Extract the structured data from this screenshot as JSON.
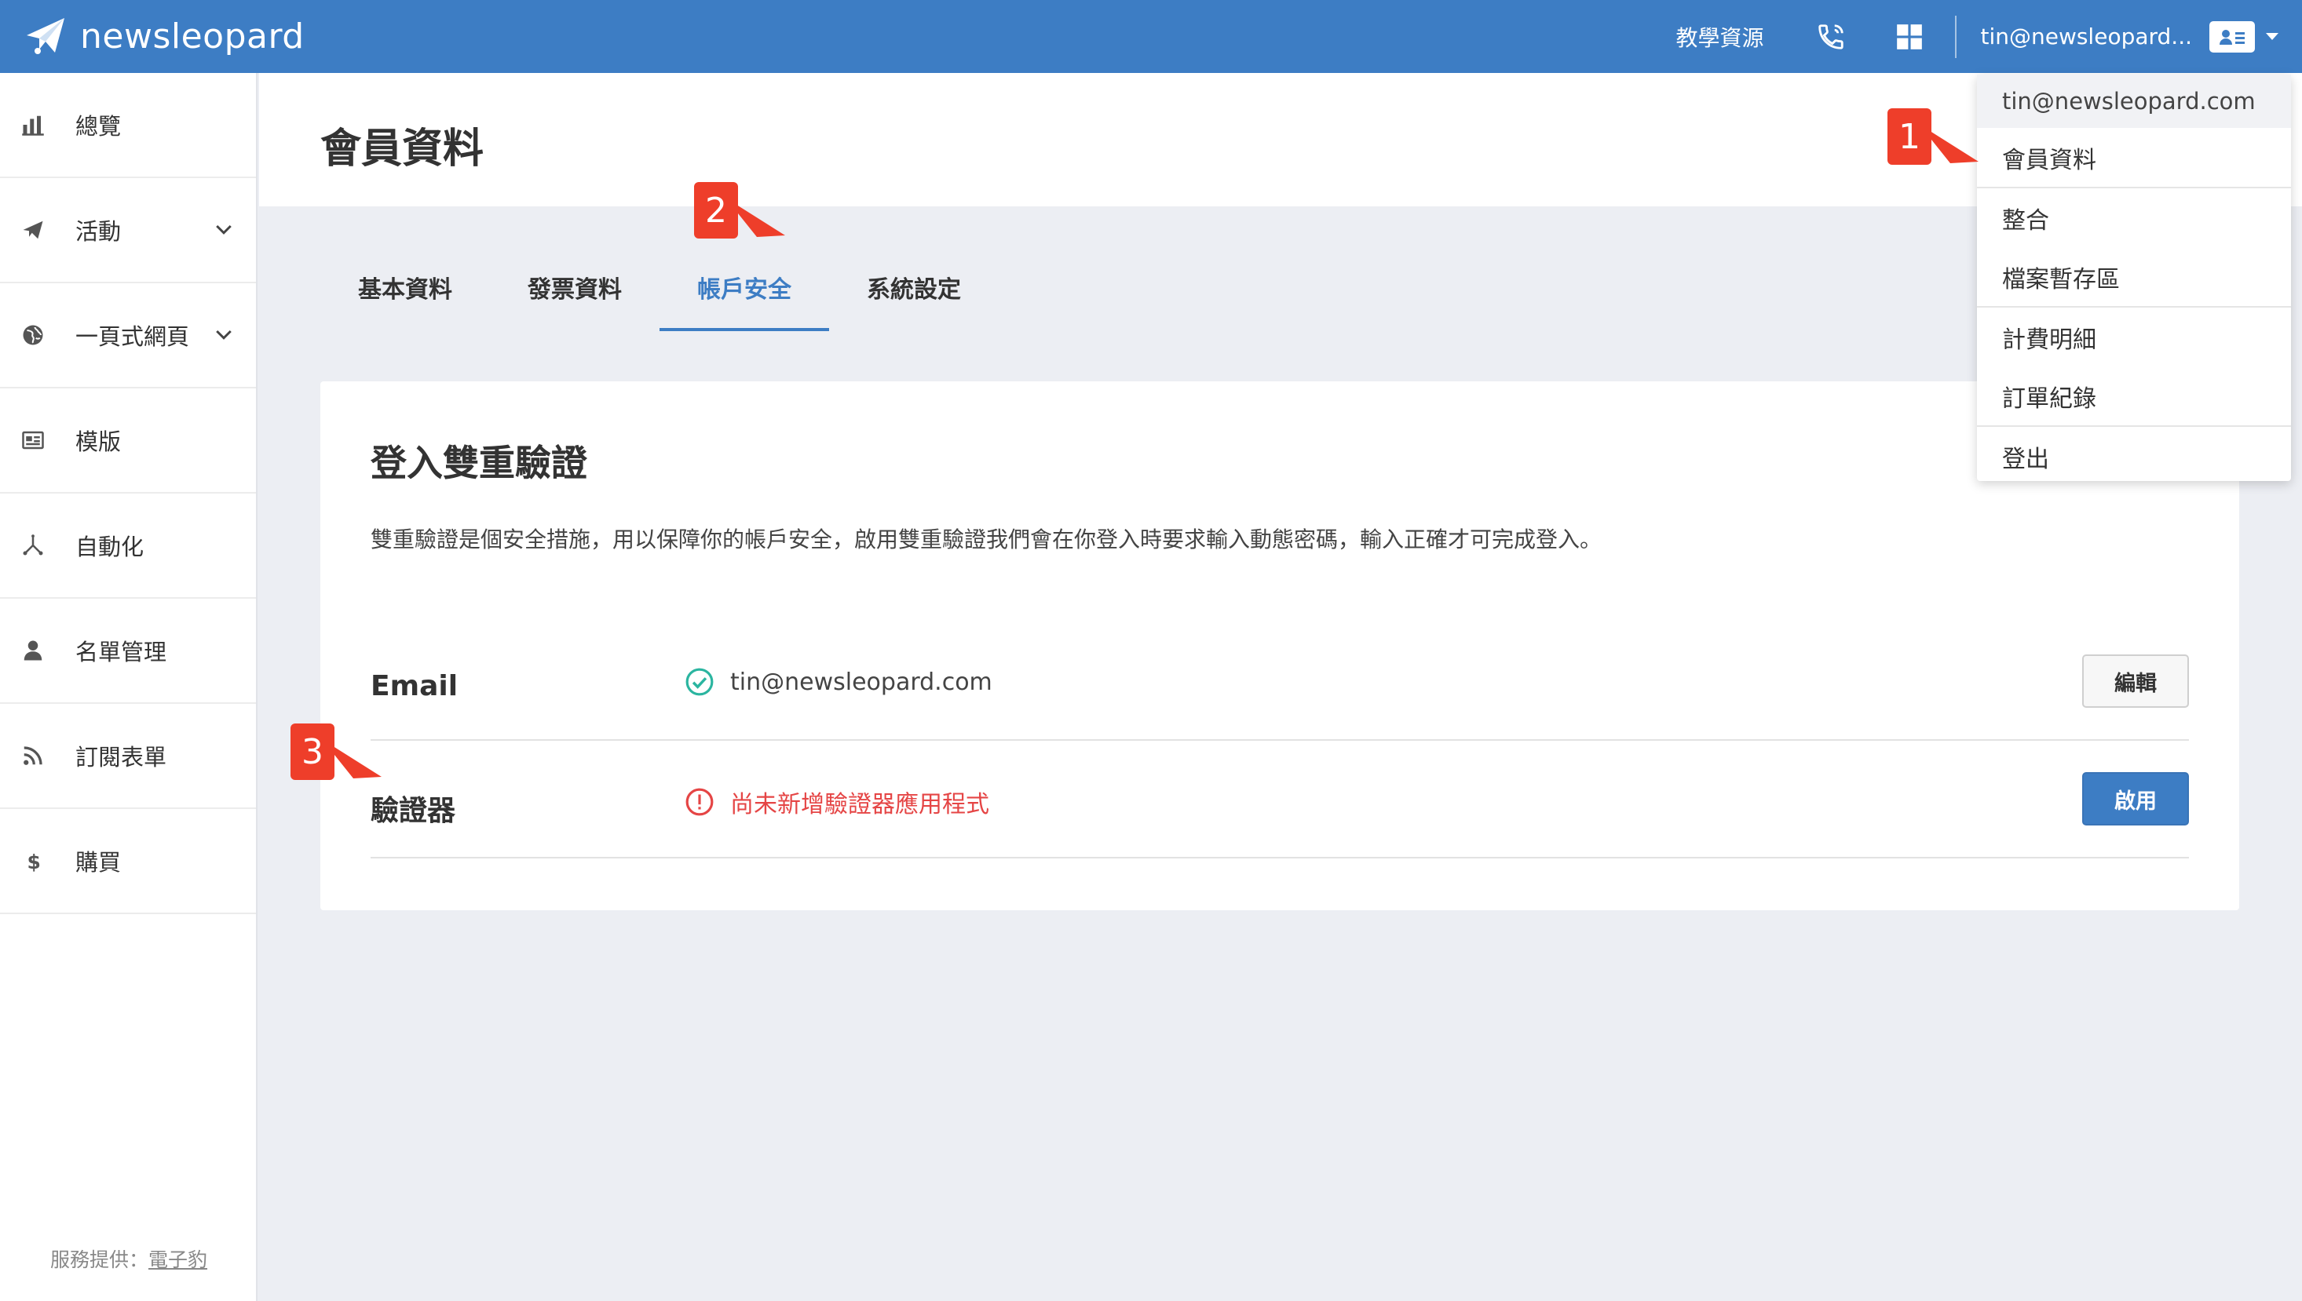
{
  "topbar": {
    "logo_text": "newsleopard",
    "tutorial_label": "教學資源",
    "user_email_truncated": "tin@newsleopard...",
    "phone_icon": "phone-icon",
    "apps_icon": "grid-icon",
    "avatar_icon": "contact-card-icon"
  },
  "sidebar": {
    "items": [
      {
        "label": "總覽",
        "icon": "bar-chart-icon",
        "has_submenu": false
      },
      {
        "label": "活動",
        "icon": "paper-plane-icon",
        "has_submenu": true
      },
      {
        "label": "一頁式網頁",
        "icon": "globe-icon",
        "has_submenu": true
      },
      {
        "label": "模版",
        "icon": "newspaper-icon",
        "has_submenu": false
      },
      {
        "label": "自動化",
        "icon": "flow-icon",
        "has_submenu": false
      },
      {
        "label": "名單管理",
        "icon": "user-icon",
        "has_submenu": false
      },
      {
        "label": "訂閱表單",
        "icon": "rss-icon",
        "has_submenu": false
      },
      {
        "label": "購買",
        "icon": "dollar-icon",
        "has_submenu": false
      }
    ],
    "footer_prefix": "服務提供：",
    "footer_link": "電子豹"
  },
  "page": {
    "title": "會員資料"
  },
  "tabs": [
    {
      "label": "基本資料",
      "active": false
    },
    {
      "label": "發票資料",
      "active": false
    },
    {
      "label": "帳戶安全",
      "active": true
    },
    {
      "label": "系統設定",
      "active": false
    }
  ],
  "card": {
    "title": "登入雙重驗證",
    "description": "雙重驗證是個安全措施，用以保障你的帳戶安全，啟用雙重驗證我們會在你登入時要求輸入動態密碼，輸入正確才可完成登入。",
    "rows": [
      {
        "label": "Email",
        "status_text": "tin@newsleopard.com",
        "status": "verified",
        "button": "編輯"
      },
      {
        "label": "驗證器",
        "status_text": "尚未新增驗證器應用程式",
        "status": "missing",
        "button": "啟用"
      }
    ]
  },
  "dropdown": {
    "email": "tin@newsleopard.com",
    "items": [
      "會員資料",
      "整合",
      "檔案暫存區",
      "計費明細",
      "訂單紀錄",
      "登出"
    ]
  },
  "callouts": [
    "1",
    "2",
    "3"
  ],
  "colors": {
    "primary": "#3d7dc4",
    "error": "#e54545",
    "success": "#2bb5a0",
    "callout": "#ee3e2a"
  }
}
